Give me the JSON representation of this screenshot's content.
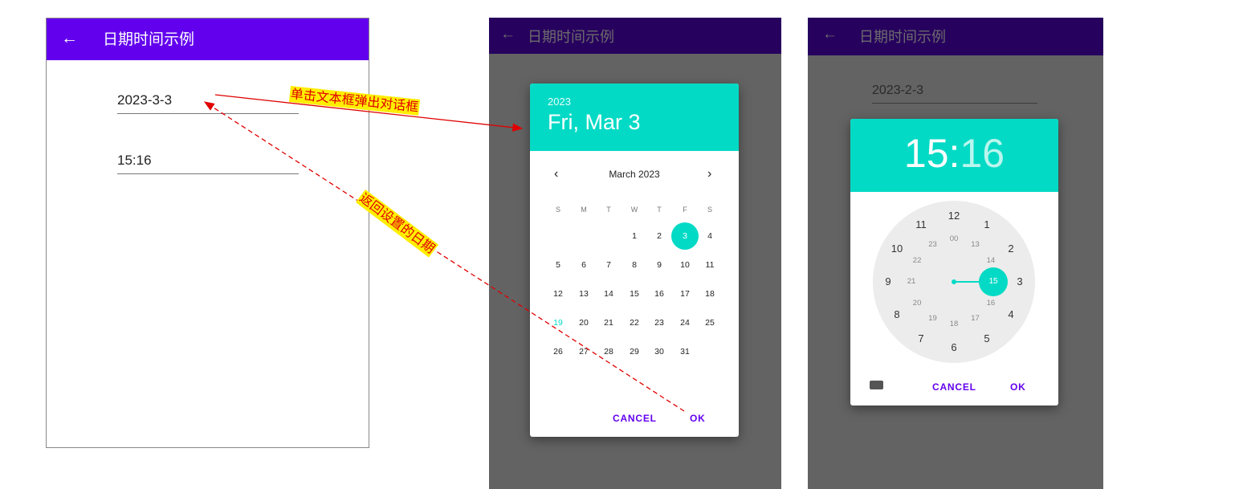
{
  "phone1": {
    "title": "日期时间示例",
    "back_icon": "←",
    "date_value": "2023-3-3",
    "time_value": "15:16"
  },
  "phone2": {
    "title": "日期时间示例",
    "back_icon": "←",
    "date_dialog": {
      "year": "2023",
      "date_headline": "Fri, Mar 3",
      "month_label": "March 2023",
      "prev_icon": "‹",
      "next_icon": "›",
      "weekdays": [
        "S",
        "M",
        "T",
        "W",
        "T",
        "F",
        "S"
      ],
      "weeks": [
        [
          "",
          "",
          "",
          "1",
          "2",
          "3",
          "4"
        ],
        [
          "5",
          "6",
          "7",
          "8",
          "9",
          "10",
          "11"
        ],
        [
          "12",
          "13",
          "14",
          "15",
          "16",
          "17",
          "18"
        ],
        [
          "19",
          "20",
          "21",
          "22",
          "23",
          "24",
          "25"
        ],
        [
          "26",
          "27",
          "28",
          "29",
          "30",
          "31",
          ""
        ]
      ],
      "selected_day": "3",
      "today_day": "19",
      "cancel_label": "CANCEL",
      "ok_label": "OK"
    }
  },
  "phone3": {
    "title": "日期时间示例",
    "back_icon": "←",
    "date_value": "2023-2-3",
    "time_dialog": {
      "hour": "15",
      "colon": ":",
      "minute": "16",
      "outer_numbers": [
        "12",
        "1",
        "2",
        "3",
        "4",
        "5",
        "6",
        "7",
        "8",
        "9",
        "10",
        "11"
      ],
      "inner_numbers": [
        "00",
        "13",
        "14",
        "15",
        "16",
        "17",
        "18",
        "19",
        "20",
        "21",
        "22",
        "23"
      ],
      "selected_hour": "15",
      "cancel_label": "CANCEL",
      "ok_label": "OK"
    }
  },
  "annotations": {
    "click_popup": "单击文本框弹出对话框",
    "return_date": "返回设置的日期"
  },
  "colors": {
    "primary": "#6200ee",
    "accent": "#03dac5",
    "annotation_arrow": "#e00000",
    "annotation_bg": "#ffee00"
  }
}
